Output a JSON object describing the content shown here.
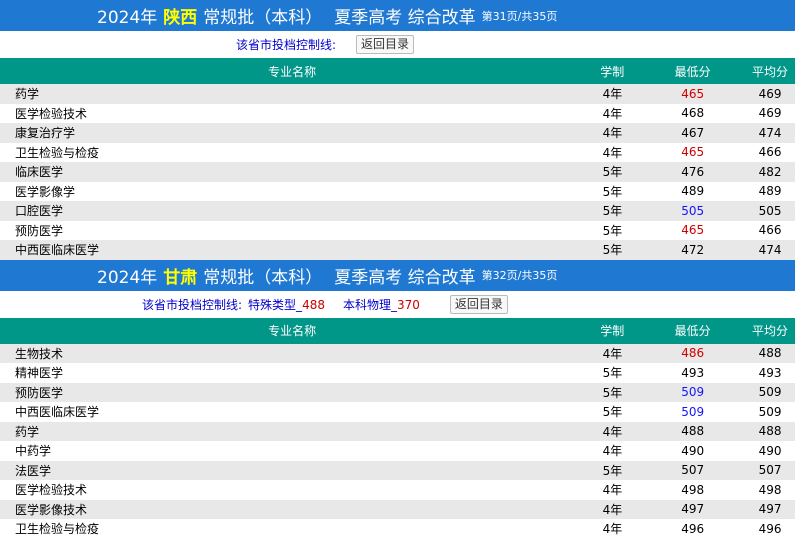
{
  "sections": [
    {
      "year": "2024年",
      "province": "陕西",
      "batch": "常规批（本科）",
      "exam": "夏季高考 综合改革",
      "page": "第31页/共35页",
      "control_label": "该省市投档控制线:",
      "control_values": [],
      "back_label": "返回目录",
      "columns": [
        "专业名称",
        "学制",
        "最低分",
        "平均分"
      ],
      "rows": [
        {
          "name": "药学",
          "duration": "4年",
          "min": "465",
          "min_color": "red",
          "avg": "469"
        },
        {
          "name": "医学检验技术",
          "duration": "4年",
          "min": "468",
          "min_color": "plain",
          "avg": "469"
        },
        {
          "name": "康复治疗学",
          "duration": "4年",
          "min": "467",
          "min_color": "plain",
          "avg": "474"
        },
        {
          "name": "卫生检验与检疫",
          "duration": "4年",
          "min": "465",
          "min_color": "red",
          "avg": "466"
        },
        {
          "name": "临床医学",
          "duration": "5年",
          "min": "476",
          "min_color": "plain",
          "avg": "482"
        },
        {
          "name": "医学影像学",
          "duration": "5年",
          "min": "489",
          "min_color": "plain",
          "avg": "489"
        },
        {
          "name": "口腔医学",
          "duration": "5年",
          "min": "505",
          "min_color": "blue",
          "avg": "505"
        },
        {
          "name": "预防医学",
          "duration": "5年",
          "min": "465",
          "min_color": "red",
          "avg": "466"
        },
        {
          "name": "中西医临床医学",
          "duration": "5年",
          "min": "472",
          "min_color": "plain",
          "avg": "474"
        }
      ]
    },
    {
      "year": "2024年",
      "province": "甘肃",
      "batch": "常规批（本科）",
      "exam": "夏季高考 综合改革",
      "page": "第32页/共35页",
      "control_label": "该省市投档控制线:",
      "control_values": [
        {
          "label": "特殊类型_",
          "value": "488"
        },
        {
          "label": "本科物理_",
          "value": "370"
        }
      ],
      "back_label": "返回目录",
      "columns": [
        "专业名称",
        "学制",
        "最低分",
        "平均分"
      ],
      "rows": [
        {
          "name": "生物技术",
          "duration": "4年",
          "min": "486",
          "min_color": "red",
          "avg": "488"
        },
        {
          "name": "精神医学",
          "duration": "5年",
          "min": "493",
          "min_color": "plain",
          "avg": "493"
        },
        {
          "name": "预防医学",
          "duration": "5年",
          "min": "509",
          "min_color": "blue",
          "avg": "509"
        },
        {
          "name": "中西医临床医学",
          "duration": "5年",
          "min": "509",
          "min_color": "blue",
          "avg": "509"
        },
        {
          "name": "药学",
          "duration": "4年",
          "min": "488",
          "min_color": "plain",
          "avg": "488"
        },
        {
          "name": "中药学",
          "duration": "4年",
          "min": "490",
          "min_color": "plain",
          "avg": "490"
        },
        {
          "name": "法医学",
          "duration": "5年",
          "min": "507",
          "min_color": "plain",
          "avg": "507"
        },
        {
          "name": "医学检验技术",
          "duration": "4年",
          "min": "498",
          "min_color": "plain",
          "avg": "498"
        },
        {
          "name": "医学影像技术",
          "duration": "4年",
          "min": "497",
          "min_color": "plain",
          "avg": "497"
        },
        {
          "name": "卫生检验与检疫",
          "duration": "4年",
          "min": "496",
          "min_color": "plain",
          "avg": "496"
        }
      ]
    }
  ]
}
